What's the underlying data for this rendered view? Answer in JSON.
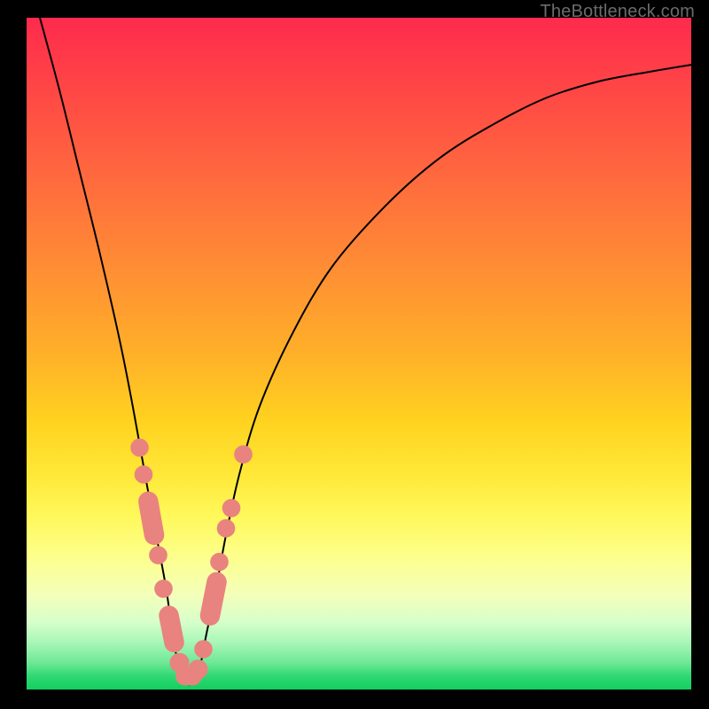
{
  "watermark": "TheBottleneck.com",
  "colors": {
    "dot": "#e9837f",
    "curve": "#000000"
  },
  "chart_data": {
    "type": "line",
    "title": "",
    "xlabel": "",
    "ylabel": "",
    "xlim": [
      0,
      100
    ],
    "ylim": [
      0,
      100
    ],
    "note": "Axes are unlabeled; x and y are normalized 0–100 to the visible plotting area. y=0 is the bottom (green) edge, y=100 is the top (red) edge. The curve is a V-shaped bottleneck trace with minimum near x≈24.",
    "series": [
      {
        "name": "bottleneck-curve",
        "x": [
          2,
          5,
          8,
          11,
          14,
          16,
          18,
          19.5,
          21,
          22,
          23,
          24,
          25,
          26,
          27,
          28.5,
          30,
          32,
          35,
          40,
          46,
          54,
          62,
          70,
          78,
          86,
          94,
          100
        ],
        "y": [
          100,
          89,
          77,
          65,
          52,
          42,
          31,
          23,
          15,
          8,
          3,
          1,
          1,
          3,
          8,
          15,
          23,
          32,
          42,
          53,
          63,
          72,
          79,
          84,
          88,
          90.5,
          92,
          93
        ]
      }
    ],
    "markers": {
      "name": "highlight-dots",
      "note": "Coral dots/pills clustered along the lower V of the curve.",
      "points": [
        {
          "x": 17.0,
          "y": 36,
          "r": 1.3
        },
        {
          "x": 17.6,
          "y": 32,
          "r": 1.3
        },
        {
          "x": 18.3,
          "y": 28,
          "r": 1.5,
          "pill_to": {
            "x": 19.2,
            "y": 23
          }
        },
        {
          "x": 19.8,
          "y": 20,
          "r": 1.3
        },
        {
          "x": 20.6,
          "y": 15,
          "r": 1.3
        },
        {
          "x": 21.4,
          "y": 11,
          "r": 1.5,
          "pill_to": {
            "x": 22.2,
            "y": 7
          }
        },
        {
          "x": 22.2,
          "y": 7,
          "r": 1.4
        },
        {
          "x": 23.0,
          "y": 4,
          "r": 1.4
        },
        {
          "x": 23.8,
          "y": 2,
          "r": 1.4,
          "pill_to": {
            "x": 25.0,
            "y": 2
          }
        },
        {
          "x": 25.8,
          "y": 3,
          "r": 1.4
        },
        {
          "x": 26.6,
          "y": 6,
          "r": 1.3
        },
        {
          "x": 27.6,
          "y": 11,
          "r": 1.5,
          "pill_to": {
            "x": 28.6,
            "y": 16
          }
        },
        {
          "x": 29.0,
          "y": 19,
          "r": 1.3
        },
        {
          "x": 30.0,
          "y": 24,
          "r": 1.3
        },
        {
          "x": 30.8,
          "y": 27,
          "r": 1.3
        },
        {
          "x": 32.6,
          "y": 35,
          "r": 1.3
        }
      ]
    }
  }
}
